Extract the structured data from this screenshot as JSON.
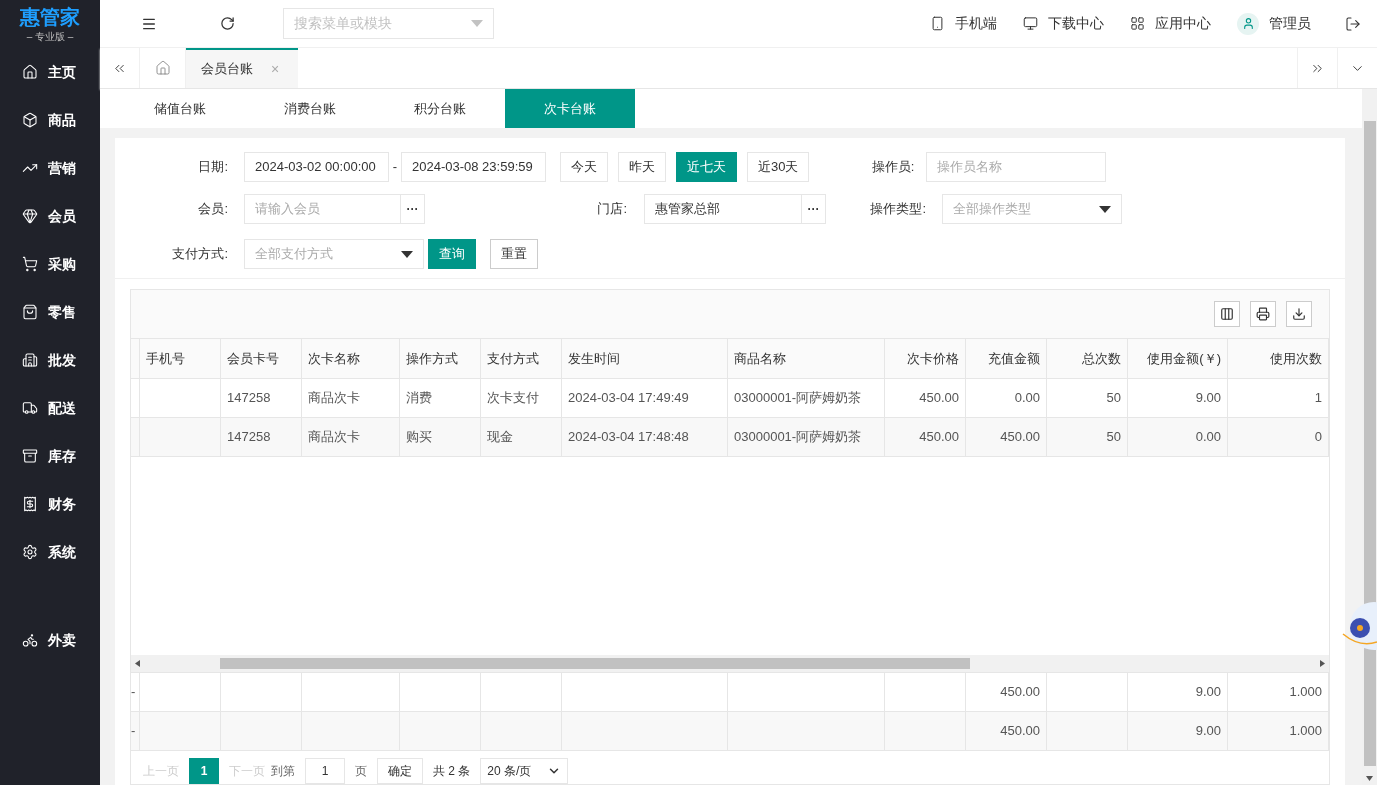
{
  "brand": {
    "logo": "惠管家",
    "edition": "– 专业版 –"
  },
  "sidebar": {
    "items": [
      {
        "label": "主页",
        "selected": false
      },
      {
        "label": "商品",
        "selected": false
      },
      {
        "label": "营销",
        "selected": false
      },
      {
        "label": "会员",
        "selected": false
      },
      {
        "label": "采购",
        "selected": false
      },
      {
        "label": "零售",
        "selected": false
      },
      {
        "label": "批发",
        "selected": false
      },
      {
        "label": "配送",
        "selected": false
      },
      {
        "label": "库存",
        "selected": false
      },
      {
        "label": "财务",
        "selected": false
      },
      {
        "label": "系统",
        "selected": false
      }
    ],
    "extra_items": [
      {
        "label": "外卖",
        "selected": false
      }
    ]
  },
  "topbar": {
    "search": {
      "placeholder": "搜索菜单或模块"
    },
    "links": [
      "手机端",
      "下载中心",
      "应用中心",
      "管理员"
    ]
  },
  "page_tabs": [
    {
      "label": "会员台账",
      "selected": true,
      "close": "×"
    }
  ],
  "sub_tabs": [
    {
      "label": "储值台账",
      "selected": false
    },
    {
      "label": "消费台账",
      "selected": false
    },
    {
      "label": "积分台账",
      "selected": false
    },
    {
      "label": "次卡台账",
      "selected": true
    }
  ],
  "filters": {
    "date": {
      "label": "日期:",
      "start": "2024-03-02 00:00:00",
      "separator": "-",
      "end": "2024-03-08 23:59:59"
    },
    "quick_ranges": [
      {
        "label": "今天",
        "selected": false
      },
      {
        "label": "昨天",
        "selected": false
      },
      {
        "label": "近七天",
        "selected": true
      },
      {
        "label": "近30天",
        "selected": false
      }
    ],
    "operator": {
      "label": "操作员:",
      "placeholder": "操作员名称"
    },
    "member": {
      "label": "会员:",
      "placeholder": "请输入会员",
      "more": "···"
    },
    "store": {
      "label": "门店:",
      "value": "惠管家总部",
      "more": "···"
    },
    "operation_type": {
      "label": "操作类型:",
      "placeholder": "全部操作类型"
    },
    "payment": {
      "label": "支付方式:",
      "placeholder": "全部支付方式"
    },
    "buttons": [
      {
        "label": "查询",
        "kind": "primary"
      },
      {
        "label": "重置",
        "kind": "default"
      }
    ]
  },
  "table": {
    "columns": [
      {
        "label": "手机号",
        "numeric": false
      },
      {
        "label": "会员卡号",
        "numeric": false
      },
      {
        "label": "次卡名称",
        "numeric": false
      },
      {
        "label": "操作方式",
        "numeric": false
      },
      {
        "label": "支付方式",
        "numeric": false
      },
      {
        "label": "发生时间",
        "numeric": false
      },
      {
        "label": "商品名称",
        "numeric": false
      },
      {
        "label": "次卡价格",
        "numeric": true
      },
      {
        "label": "充值金额",
        "numeric": true
      },
      {
        "label": "总次数",
        "numeric": true
      },
      {
        "label": "使用金额(￥)",
        "numeric": true
      },
      {
        "label": "使用次数",
        "numeric": true
      }
    ],
    "rows": [
      [
        "",
        "147258",
        "商品次卡",
        "消费",
        "次卡支付",
        "2024-03-04 17:49:49",
        "03000001-阿萨姆奶茶",
        "450.00",
        "0.00",
        "50",
        "9.00",
        "1"
      ],
      [
        "",
        "147258",
        "商品次卡",
        "购买",
        "现金",
        "2024-03-04 17:48:48",
        "03000001-阿萨姆奶茶",
        "450.00",
        "450.00",
        "50",
        "0.00",
        "0"
      ]
    ],
    "summary_rows": [
      {
        "marker": "-",
        "cells": [
          "",
          "",
          "",
          "",
          "",
          "",
          "",
          "",
          "450.00",
          "",
          "9.00",
          "1.000"
        ]
      },
      {
        "marker": "-",
        "cells": [
          "",
          "",
          "",
          "",
          "",
          "",
          "",
          "",
          "450.00",
          "",
          "9.00",
          "1.000"
        ]
      }
    ]
  },
  "pagination": {
    "prev": "上一页",
    "pages": [
      {
        "label": "1",
        "selected": true
      }
    ],
    "next": "下一页",
    "goto": "到第",
    "page_input": "1",
    "page_unit": "页",
    "confirm": "确定",
    "total": "共 2 条",
    "page_size": "20 条/页"
  }
}
